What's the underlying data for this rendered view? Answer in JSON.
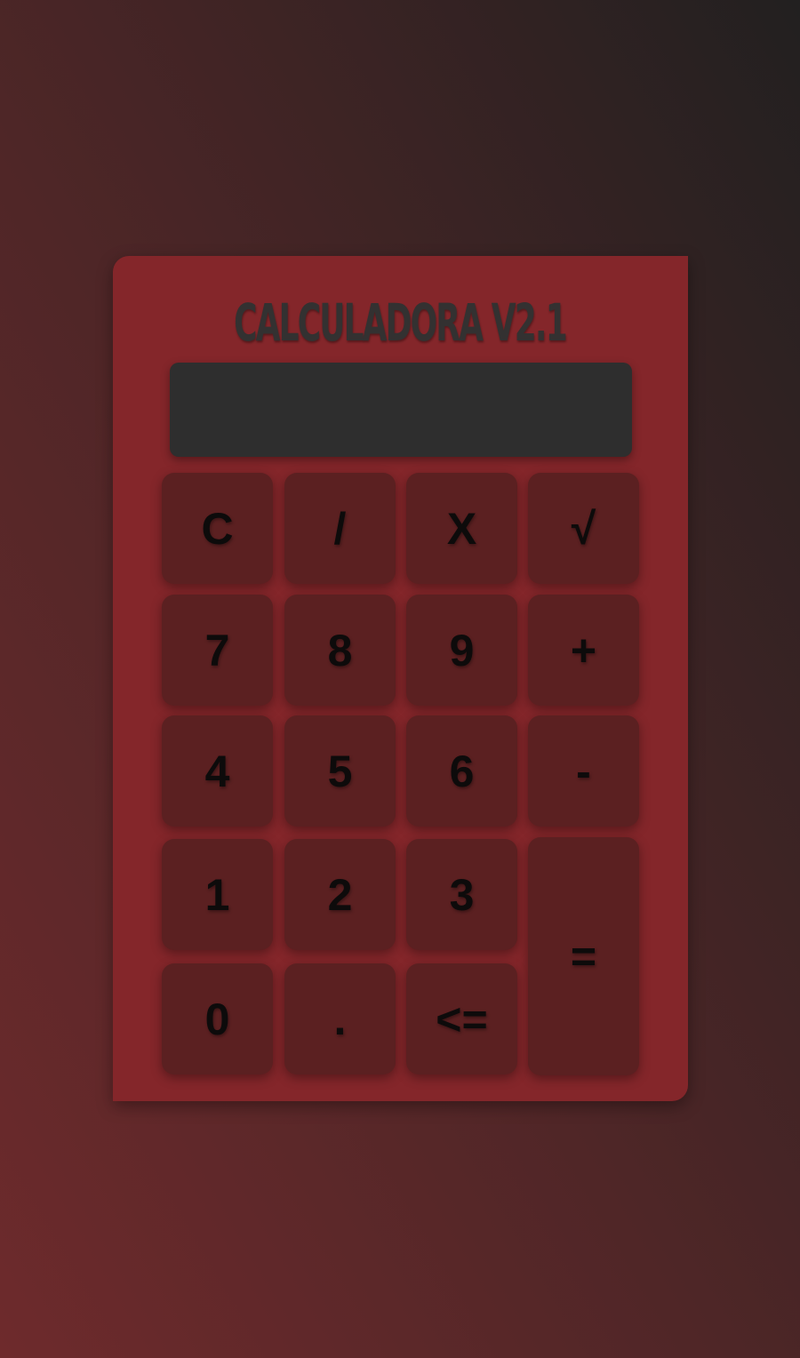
{
  "app": {
    "title": "CALCULADORA V2.1",
    "display_value": ""
  },
  "colors": {
    "background_light": "#6e2a2c",
    "background_dark": "#222020",
    "calculator_body": "#84262a",
    "display": "#2e2e2e",
    "key": "#5b2021",
    "key_text": "#0d0b0b",
    "title_text": "#333131"
  },
  "keys": {
    "clear": "C",
    "divide": "/",
    "multiply": "X",
    "sqrt": "√",
    "seven": "7",
    "eight": "8",
    "nine": "9",
    "plus": "+",
    "four": "4",
    "five": "5",
    "six": "6",
    "minus": "-",
    "one": "1",
    "two": "2",
    "three": "3",
    "equals": "=",
    "zero": "0",
    "decimal": ".",
    "backspace": "<="
  }
}
